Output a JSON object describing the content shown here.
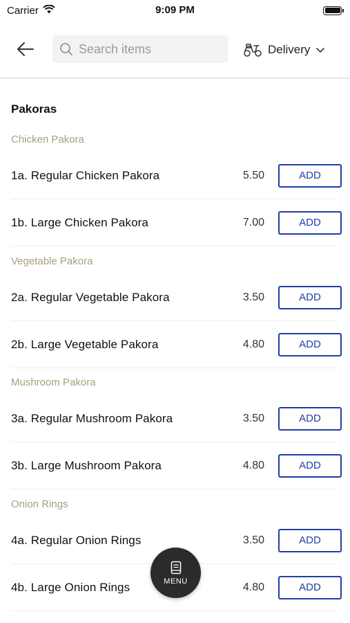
{
  "status_bar": {
    "carrier": "Carrier",
    "time": "9:09 PM"
  },
  "header": {
    "search_placeholder": "Search items",
    "delivery_label": "Delivery"
  },
  "menu": {
    "section_title": "Pakoras",
    "categories": [
      {
        "name": "Chicken Pakora",
        "items": [
          {
            "name": "1a. Regular Chicken Pakora",
            "price": "5.50",
            "button": "ADD"
          },
          {
            "name": "1b. Large Chicken Pakora",
            "price": "7.00",
            "button": "ADD"
          }
        ]
      },
      {
        "name": "Vegetable Pakora",
        "items": [
          {
            "name": "2a. Regular Vegetable Pakora",
            "price": "3.50",
            "button": "ADD"
          },
          {
            "name": "2b. Large Vegetable Pakora",
            "price": "4.80",
            "button": "ADD"
          }
        ]
      },
      {
        "name": "Mushroom Pakora",
        "items": [
          {
            "name": "3a. Regular Mushroom Pakora",
            "price": "3.50",
            "button": "ADD"
          },
          {
            "name": "3b. Large Mushroom Pakora",
            "price": "4.80",
            "button": "ADD"
          }
        ]
      },
      {
        "name": "Onion Rings",
        "items": [
          {
            "name": "4a. Regular Onion Rings",
            "price": "3.50",
            "button": "ADD"
          },
          {
            "name": "4b. Large Onion Rings",
            "price": "4.80",
            "button": "ADD"
          }
        ]
      }
    ]
  },
  "fab": {
    "label": "MENU"
  },
  "colors": {
    "accent": "#1f3fa6",
    "category_text": "#a79f79",
    "fab_bg": "#2b2b2b"
  },
  "icons": {
    "back": "back-arrow-icon",
    "search": "search-icon",
    "delivery": "scooter-icon",
    "dropdown": "chevron-down-icon",
    "menu": "menu-book-icon"
  }
}
